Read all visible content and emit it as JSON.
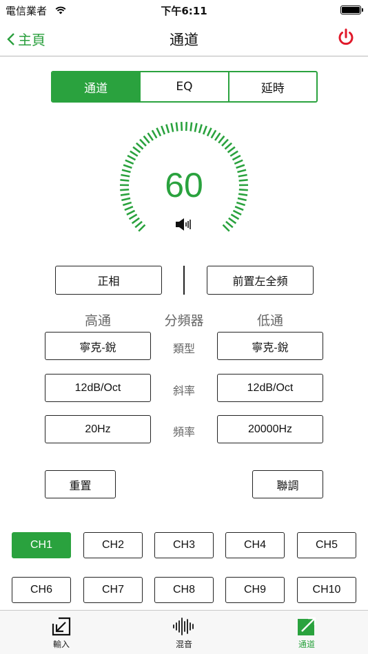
{
  "status": {
    "carrier": "電信業者",
    "time": "下午6:11"
  },
  "nav": {
    "back_label": "主頁",
    "title": "通道"
  },
  "segments": [
    {
      "label": "通道",
      "active": true
    },
    {
      "label": "EQ",
      "active": false
    },
    {
      "label": "延時",
      "active": false
    }
  ],
  "dial": {
    "value": "60",
    "level": 0.6
  },
  "phase": {
    "phase_label": "正相",
    "preset_label": "前置左全頻"
  },
  "crossover": {
    "high_label": "高通",
    "title": "分頻器",
    "low_label": "低通",
    "rows": [
      {
        "label": "類型",
        "high": "寧克-銳",
        "low": "寧克-銳"
      },
      {
        "label": "斜率",
        "high": "12dB/Oct",
        "low": "12dB/Oct"
      },
      {
        "label": "頻率",
        "high": "20Hz",
        "low": "20000Hz"
      }
    ]
  },
  "actions": {
    "reset_label": "重置",
    "link_label": "聯調"
  },
  "channels": [
    "CH1",
    "CH2",
    "CH3",
    "CH4",
    "CH5",
    "CH6",
    "CH7",
    "CH8",
    "CH9",
    "CH10"
  ],
  "active_channel": "CH1",
  "tabs": [
    {
      "label": "輸入",
      "icon": "input-arrow-icon",
      "active": false
    },
    {
      "label": "混音",
      "icon": "waveform-icon",
      "active": false
    },
    {
      "label": "通道",
      "icon": "output-arrow-icon",
      "active": true
    }
  ],
  "colors": {
    "accent": "#2aa23e",
    "power": "#e0192a"
  }
}
